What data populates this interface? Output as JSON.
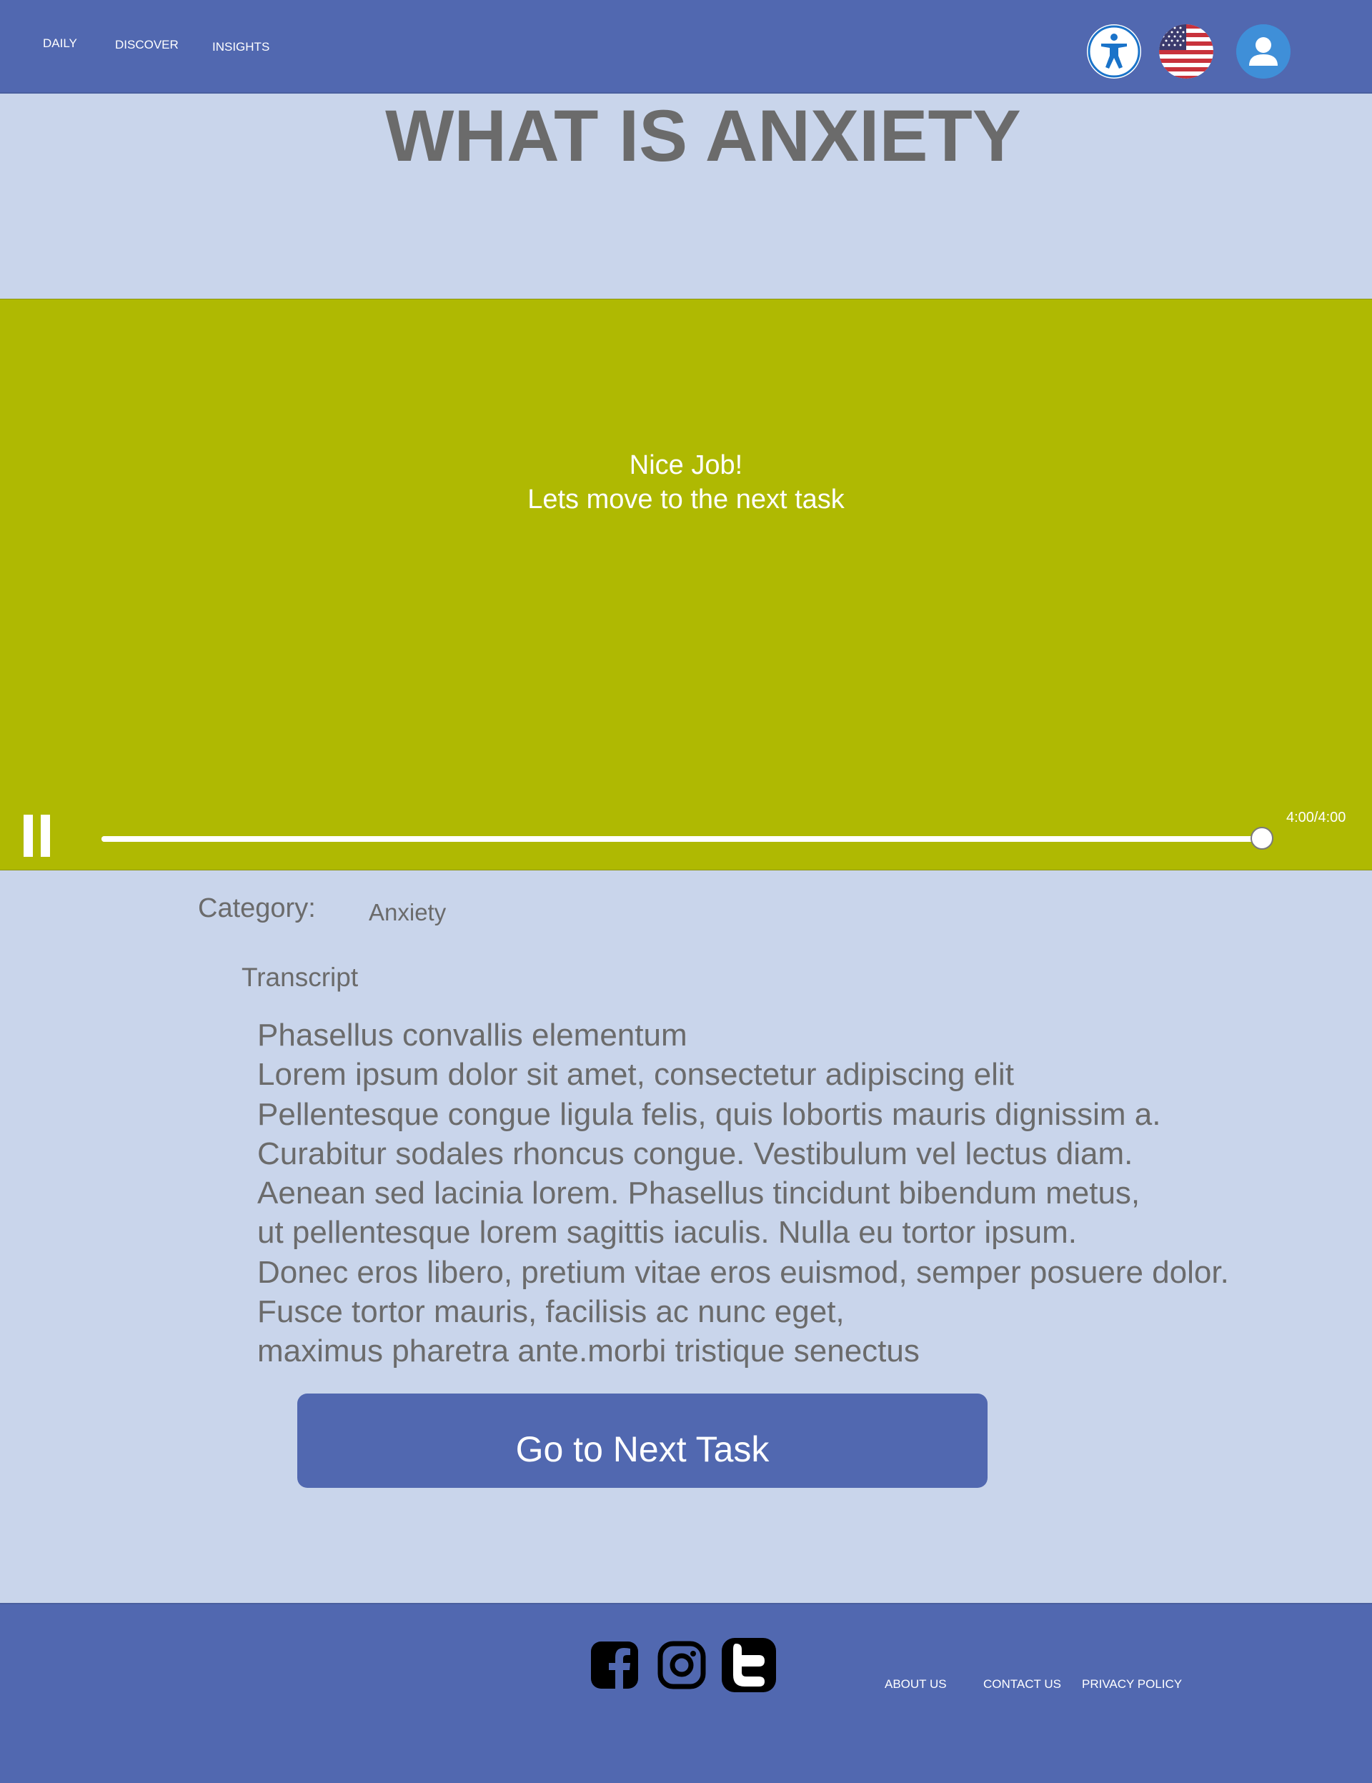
{
  "header": {
    "nav": {
      "daily": "DAILY",
      "discover": "DISCOVER",
      "insights": "INSIGHTS"
    },
    "icons": [
      "accessibility-icon",
      "us-flag-icon",
      "user-avatar-icon"
    ]
  },
  "page": {
    "title": "WHAT IS ANXIETY"
  },
  "video": {
    "message_line1": "Nice Job!",
    "message_line2": "Lets move to the next task",
    "time": "4:00/4:00",
    "progress_fraction": 1.0,
    "state": "playing",
    "control_icon": "pause-icon",
    "background_color": "#afb902"
  },
  "content": {
    "category_label": "Category:",
    "category_value": "Anxiety",
    "transcript_label": "Transcript",
    "transcript_lines": [
      "Phasellus convallis elementum",
      "Lorem ipsum dolor sit amet, consectetur adipiscing elit",
      "Pellentesque congue ligula felis, quis lobortis mauris dignissim a.",
      "Curabitur sodales rhoncus congue. Vestibulum vel lectus diam.",
      "Aenean sed lacinia lorem. Phasellus tincidunt bibendum metus,",
      "ut pellentesque lorem sagittis iaculis. Nulla eu tortor ipsum.",
      "Donec eros libero, pretium vitae eros euismod, semper posuere dolor.",
      "Fusce tortor mauris, facilisis ac nunc eget,",
      "maximus pharetra ante.morbi tristique senectus"
    ],
    "next_button": "Go to Next Task"
  },
  "footer": {
    "social_icons": [
      "facebook-icon",
      "instagram-icon",
      "twitter-icon"
    ],
    "links": {
      "about": "ABOUT US",
      "contact": "CONTACT US",
      "privacy": "PRIVACY POLICY"
    }
  },
  "colors": {
    "header_bg": "#5168b0",
    "page_bg": "#c9d5eb",
    "text": "#6b6b6b",
    "video_bg": "#afb902"
  }
}
